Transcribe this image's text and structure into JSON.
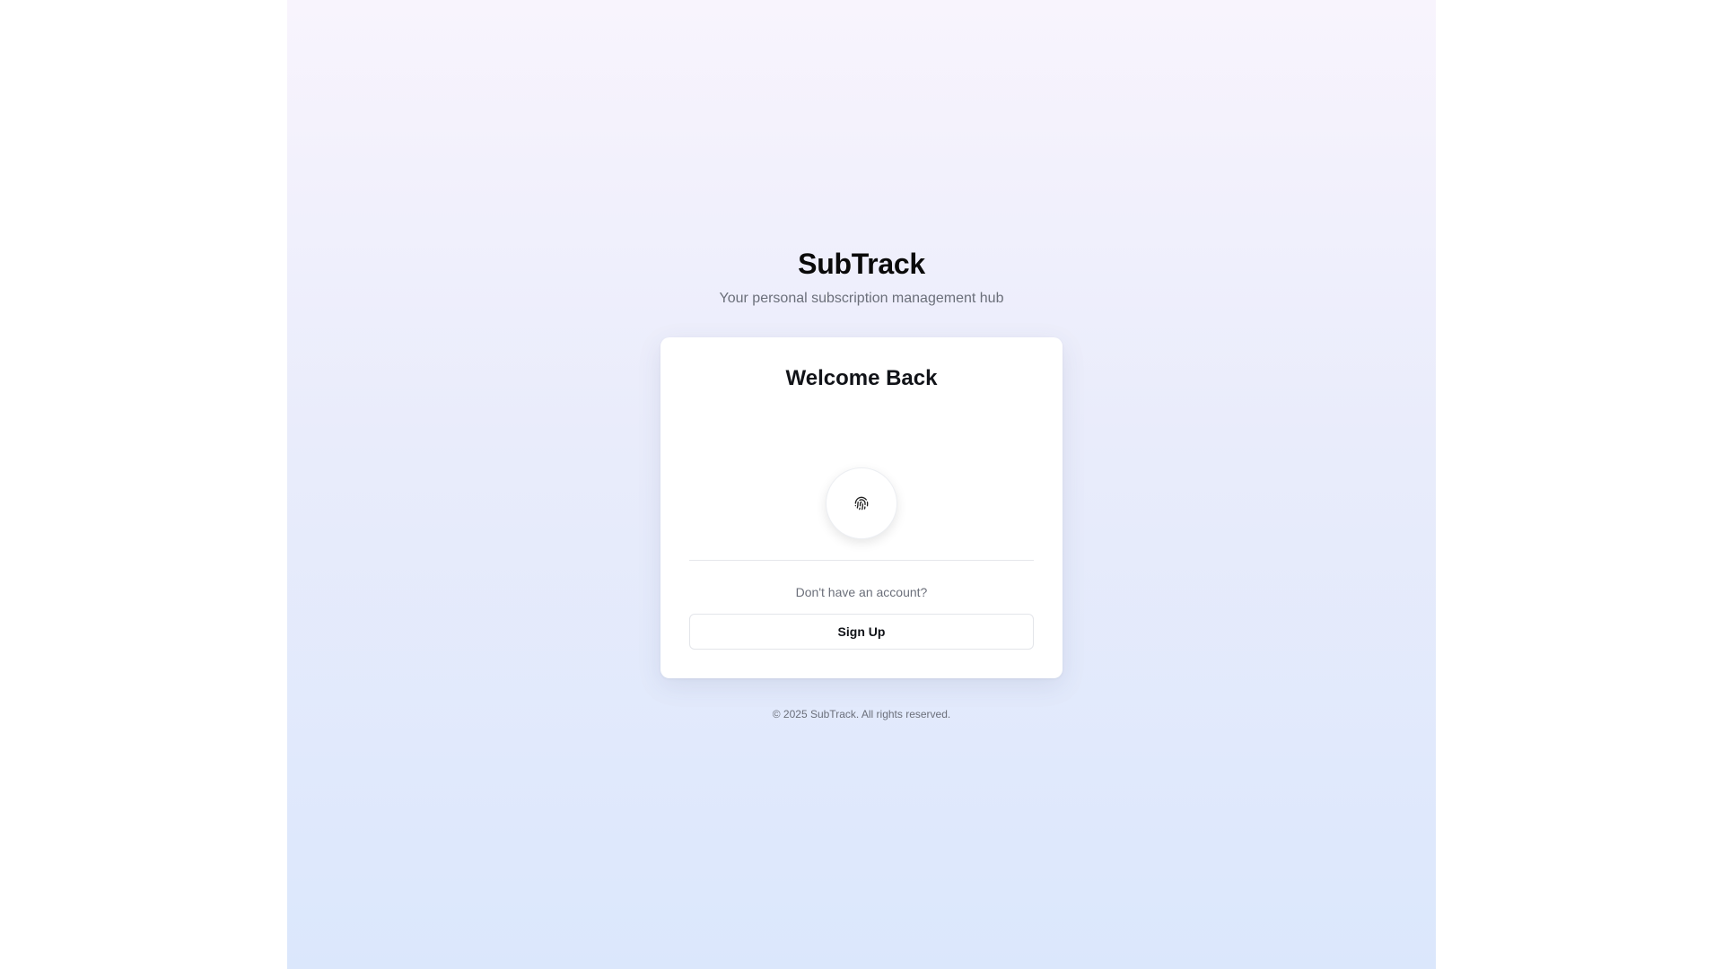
{
  "brand": {
    "title": "SubTrack",
    "subtitle": "Your personal subscription management hub"
  },
  "card": {
    "title": "Welcome Back",
    "fingerprint_icon": "fingerprint-icon",
    "prompt": "Don't have an account?",
    "signup_label": "Sign Up"
  },
  "footer": {
    "copyright": "© 2025 SubTrack. All rights reserved."
  },
  "colors": {
    "gradient_top": "#f8f4fd",
    "gradient_bottom": "#dbe7fc",
    "text_primary": "#0a0a0a",
    "text_muted": "#6b6f7a"
  }
}
